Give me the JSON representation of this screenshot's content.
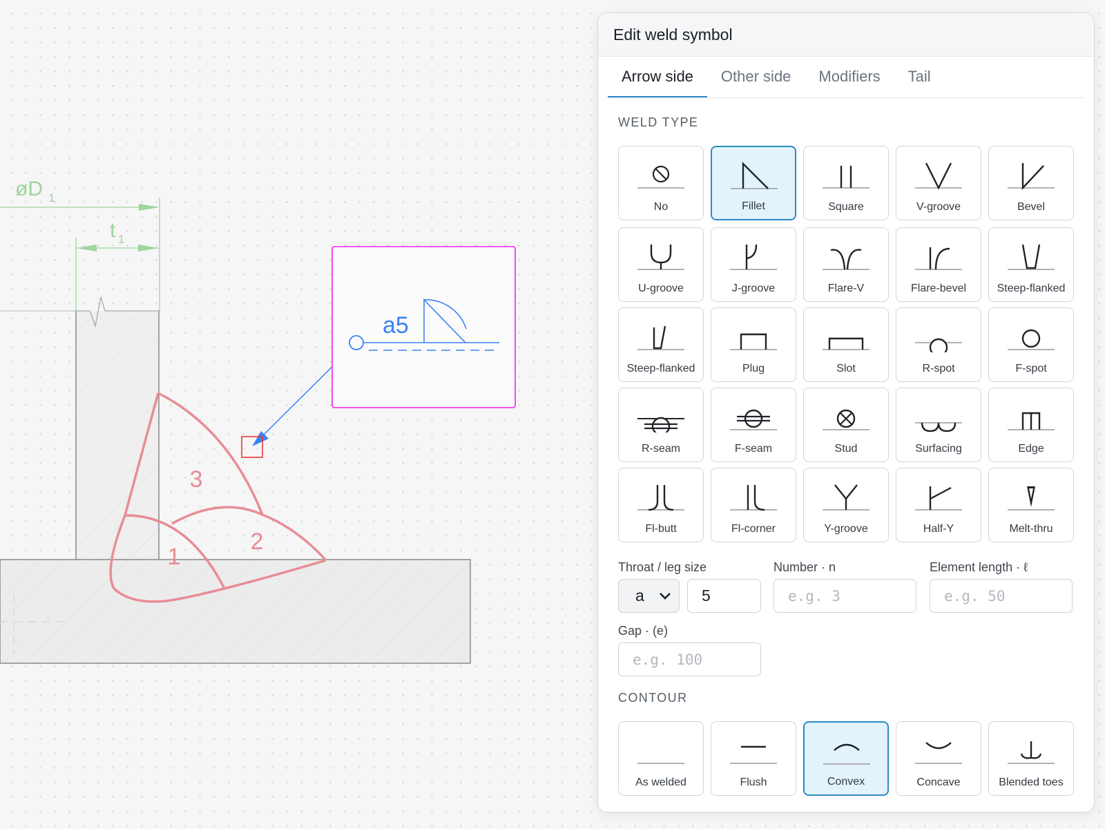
{
  "canvas": {
    "dim_diameter": "øD",
    "dim_diameter_sub": "1",
    "dim_thickness": "t",
    "dim_thickness_sub": "1",
    "weld_pass_labels": [
      "1",
      "2",
      "3"
    ],
    "weld_symbol_text": "a5"
  },
  "panel": {
    "title": "Edit weld symbol",
    "tabs": [
      "Arrow side",
      "Other side",
      "Modifiers",
      "Tail"
    ],
    "active_tab": "Arrow side",
    "weld_type_heading": "WELD TYPE",
    "weld_types": [
      {
        "label": "No",
        "icon": "no-weld-icon"
      },
      {
        "label": "Fillet",
        "icon": "fillet-icon"
      },
      {
        "label": "Square",
        "icon": "square-groove-icon"
      },
      {
        "label": "V-groove",
        "icon": "v-groove-icon"
      },
      {
        "label": "Bevel",
        "icon": "bevel-icon"
      },
      {
        "label": "U-groove",
        "icon": "u-groove-icon"
      },
      {
        "label": "J-groove",
        "icon": "j-groove-icon"
      },
      {
        "label": "Flare-V",
        "icon": "flare-v-icon"
      },
      {
        "label": "Flare-bevel",
        "icon": "flare-bevel-icon"
      },
      {
        "label": "Steep-flanked",
        "icon": "steep-flanked-v-icon"
      },
      {
        "label": "Steep-flanked",
        "icon": "steep-flanked-bevel-icon"
      },
      {
        "label": "Plug",
        "icon": "plug-icon"
      },
      {
        "label": "Slot",
        "icon": "slot-icon"
      },
      {
        "label": "R-spot",
        "icon": "resistance-spot-icon"
      },
      {
        "label": "F-spot",
        "icon": "fusion-spot-icon"
      },
      {
        "label": "R-seam",
        "icon": "resistance-seam-icon"
      },
      {
        "label": "F-seam",
        "icon": "fusion-seam-icon"
      },
      {
        "label": "Stud",
        "icon": "stud-icon"
      },
      {
        "label": "Surfacing",
        "icon": "surfacing-icon"
      },
      {
        "label": "Edge",
        "icon": "edge-icon"
      },
      {
        "label": "Fl-butt",
        "icon": "flange-butt-icon"
      },
      {
        "label": "Fl-corner",
        "icon": "flange-corner-icon"
      },
      {
        "label": "Y-groove",
        "icon": "y-groove-icon"
      },
      {
        "label": "Half-Y",
        "icon": "half-y-icon"
      },
      {
        "label": "Melt-thru",
        "icon": "melt-through-icon"
      }
    ],
    "selected_weld_type": "Fillet",
    "throat_label": "Throat / leg size",
    "throat_prefix": "a",
    "throat_value": "5",
    "number_label": "Number · n",
    "number_placeholder": "e.g. 3",
    "length_label": "Element length · ℓ",
    "length_placeholder": "e.g. 50",
    "gap_label": "Gap · (e)",
    "gap_placeholder": "e.g. 100",
    "contour_heading": "CONTOUR",
    "contours": [
      {
        "label": "As welded",
        "icon": "as-welded-icon"
      },
      {
        "label": "Flush",
        "icon": "flush-icon"
      },
      {
        "label": "Convex",
        "icon": "convex-icon"
      },
      {
        "label": "Concave",
        "icon": "concave-icon"
      },
      {
        "label": "Blended toes",
        "icon": "blended-toes-icon"
      }
    ],
    "selected_contour": "Convex"
  },
  "colors": {
    "accent": "#2b8ac4",
    "selected_bg": "#e2f3fb",
    "dimension": "#9ed49e",
    "weld_bead": "#e88c95",
    "symbol_blue": "#3b82f6",
    "symbol_frame": "#ee22ee",
    "anchor_red": "#e53935"
  }
}
